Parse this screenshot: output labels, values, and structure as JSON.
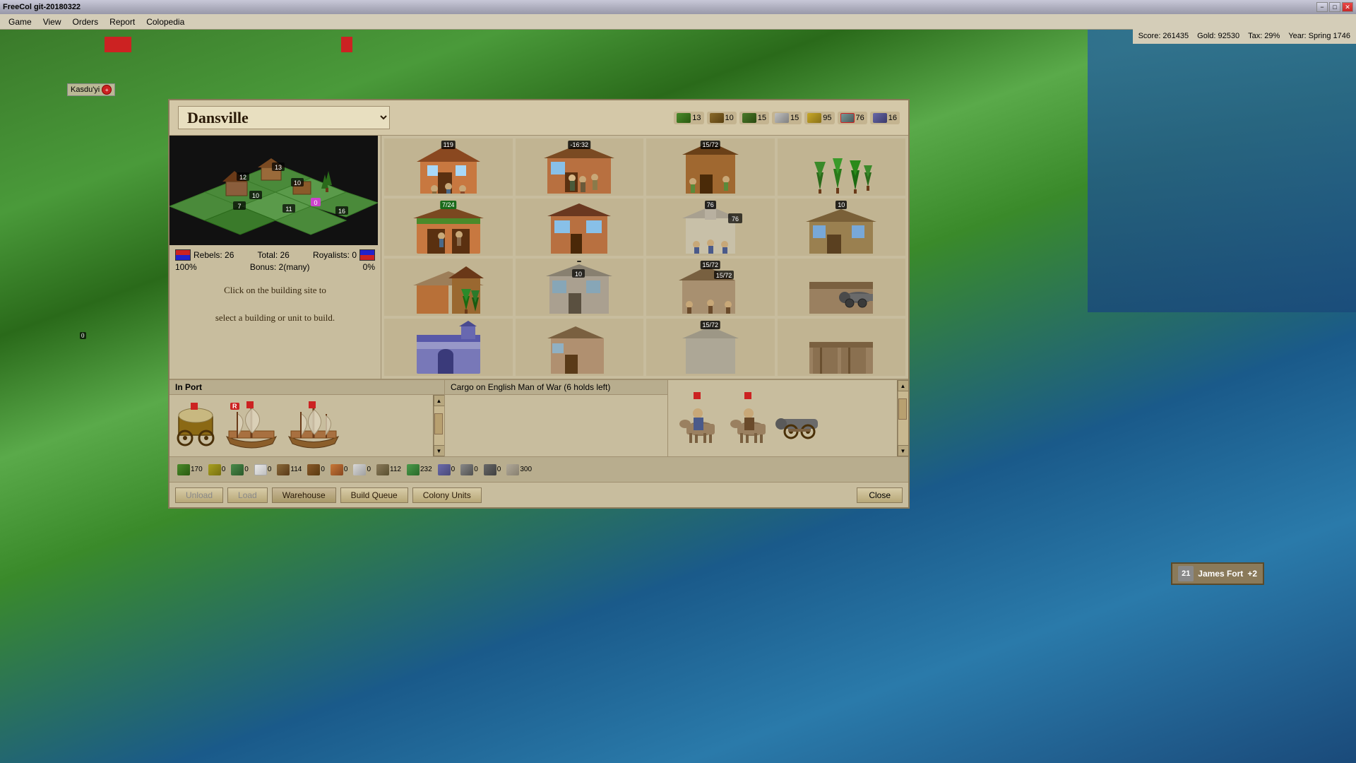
{
  "window": {
    "title": "FreeCol git-20180322",
    "controls": [
      "−",
      "□",
      "✕"
    ]
  },
  "menu": {
    "items": [
      "Game",
      "View",
      "Orders",
      "Report",
      "Colopedia"
    ]
  },
  "scorebar": {
    "score": "Score: 261435",
    "gold": "Gold: 92530",
    "tax": "Tax: 29%",
    "year": "Year: Spring 1746"
  },
  "colony_dialog": {
    "name": "Dansville",
    "resources": [
      {
        "icon": "food",
        "value": "13",
        "color": "#4a8a2a"
      },
      {
        "icon": "hammers",
        "value": "10",
        "color": "#8a6a2a"
      },
      {
        "icon": "lumber",
        "value": "15",
        "color": "#6a4a2a"
      },
      {
        "icon": "cross",
        "value": "15",
        "color": "#aaaaaa"
      },
      {
        "icon": "bell",
        "value": "95",
        "color": "#c8a828"
      },
      {
        "icon": "tools",
        "value": "76",
        "color": "#887878"
      },
      {
        "icon": "edu",
        "value": "16",
        "color": "#4a4aaa"
      }
    ],
    "stats": {
      "rebels": "Rebels: 26",
      "total": "Total: 26",
      "royalists": "Royalists: 0",
      "rebel_pct": "100%",
      "bonus": "Bonus: 2(many)",
      "royal_pct": "0%"
    },
    "hint": "Click on the building site to\n\nselect a building or unit to build.",
    "buildings": [
      {
        "name": "Town Hall",
        "badge": "119",
        "badge_type": "dark"
      },
      {
        "name": "Fur Trader House",
        "badge": "-16:32",
        "badge_type": "dark"
      },
      {
        "name": "Lumber Mill",
        "badge": "15/72",
        "badge_type": "dark"
      },
      {
        "name": "Forest/Empty",
        "badge": "",
        "badge_type": ""
      },
      {
        "name": "Stable",
        "badge": "7/24",
        "badge_type": "green"
      },
      {
        "name": "Carpenter Shop",
        "badge": "",
        "badge_type": ""
      },
      {
        "name": "Church",
        "badge": "76",
        "badge_type": "dark"
      },
      {
        "name": "Warehouse",
        "badge": "10",
        "badge_type": "dark"
      },
      {
        "name": "Farm",
        "badge": "",
        "badge_type": ""
      },
      {
        "name": "Armory",
        "badge": "",
        "badge_type": ""
      },
      {
        "name": "Watermill",
        "badge": "15/72",
        "badge_type": "dark"
      },
      {
        "name": "Trade Post",
        "badge": "",
        "badge_type": ""
      }
    ]
  },
  "in_port": {
    "header": "In Port",
    "label": "In Port",
    "ships": [
      {
        "type": "wagon",
        "name": "Wagon Train"
      },
      {
        "type": "ship",
        "name": "English Man of War",
        "flag": true
      },
      {
        "type": "ship",
        "name": "Ship 2",
        "flag": true
      }
    ]
  },
  "cargo": {
    "header": "Cargo on English Man of War (6 holds left)"
  },
  "colony_units": {
    "units": [
      {
        "type": "cavalry",
        "flag": true
      },
      {
        "type": "cavalry",
        "flag": true
      },
      {
        "type": "cannon",
        "flag": false
      }
    ]
  },
  "goods": [
    {
      "name": "food",
      "value": "170",
      "color": "#4a8a2a"
    },
    {
      "name": "grain",
      "value": "0",
      "color": "#c8a828"
    },
    {
      "name": "tobacco",
      "value": "0",
      "color": "#4a8a4a"
    },
    {
      "name": "cotton",
      "value": "0",
      "color": "#e8e8e8"
    },
    {
      "name": "fur",
      "value": "114",
      "color": "#8a6a3a"
    },
    {
      "name": "wood",
      "value": "0",
      "color": "#8a5a2a"
    },
    {
      "name": "ore",
      "value": "0",
      "color": "#c87838"
    },
    {
      "name": "silver",
      "value": "0",
      "color": "#d8d8d8"
    },
    {
      "name": "horse",
      "value": "112",
      "color": "#8a7a5a"
    },
    {
      "name": "rum",
      "value": "232",
      "color": "#c87838"
    },
    {
      "name": "cloth",
      "value": "0",
      "color": "#4a4a9a"
    },
    {
      "name": "tools",
      "value": "0",
      "color": "#888888"
    },
    {
      "name": "guns",
      "value": "0",
      "color": "#686868"
    },
    {
      "name": "unknown",
      "value": "300",
      "color": "#aaaaaa"
    }
  ],
  "buttons": {
    "unload": "Unload",
    "load": "Load",
    "warehouse": "Warehouse",
    "build_queue": "Build Queue",
    "colony_units": "Colony Units",
    "close": "Close"
  },
  "map": {
    "colony_name": "Kasdu'yi",
    "fort_name": "James Fort",
    "fort_bonus": "+2",
    "fort_number": "21"
  }
}
